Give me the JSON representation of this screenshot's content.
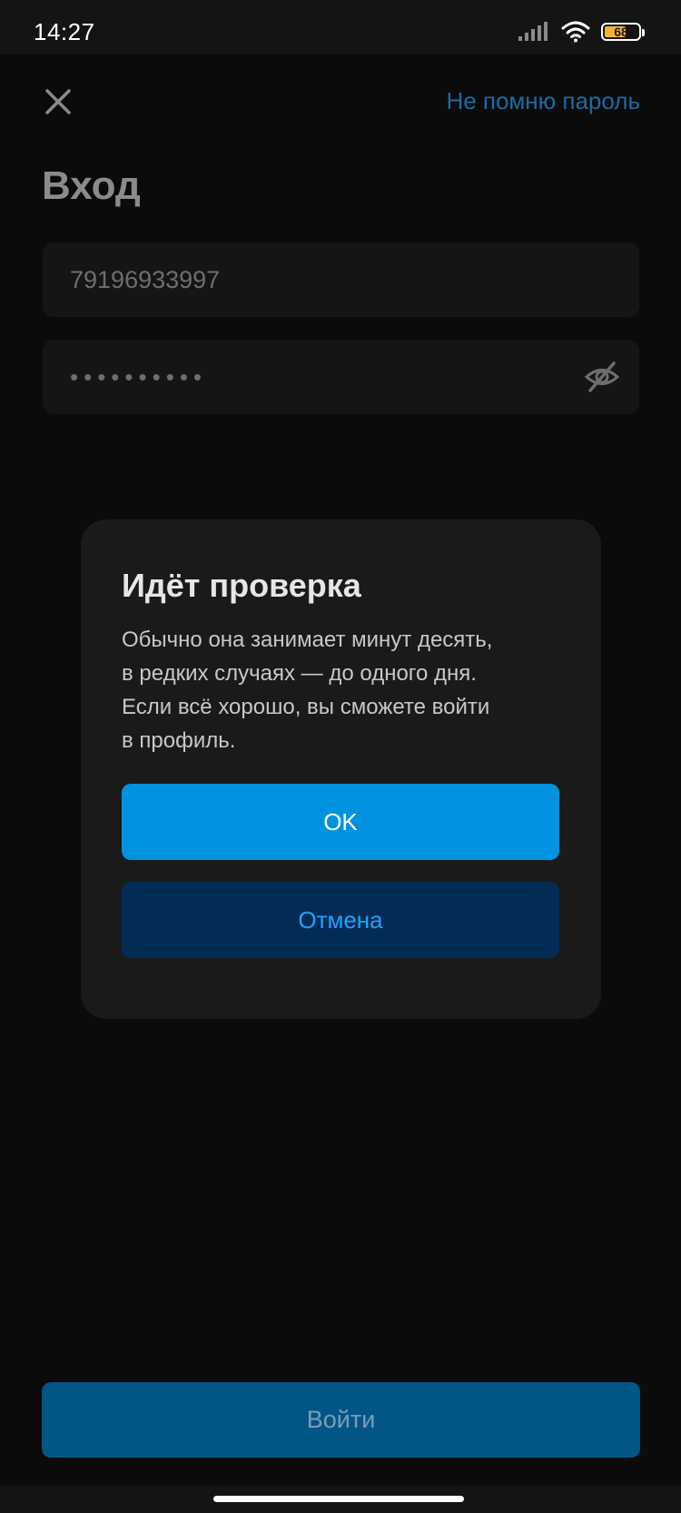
{
  "status_bar": {
    "time": "14:27",
    "battery_percent": "68",
    "battery_level": 0.68,
    "icons": [
      "signal-icon",
      "wifi-icon",
      "battery-icon"
    ]
  },
  "header": {
    "close_icon": "close-icon",
    "forgot_password": "Не помню пароль"
  },
  "page": {
    "title": "Вход"
  },
  "form": {
    "phone_value": "79196933997",
    "password_masked": "••••••••••",
    "password_toggle_icon": "eye-off-icon"
  },
  "dialog": {
    "title": "Идёт проверка",
    "body": "Обычно она занимает минут десять,\nв редких случаях — до одного дня.\nЕсли всё хорошо, вы сможете войти\nв профиль.",
    "ok_label": "OK",
    "cancel_label": "Отмена"
  },
  "footer": {
    "login_label": "Войти"
  },
  "colors": {
    "accent": "#0392e0",
    "accent_dark": "#022c53",
    "link": "#1d6aa3",
    "login_button": "#025587",
    "background": "#0b0b0b",
    "dialog_bg": "#1a1a1a"
  }
}
